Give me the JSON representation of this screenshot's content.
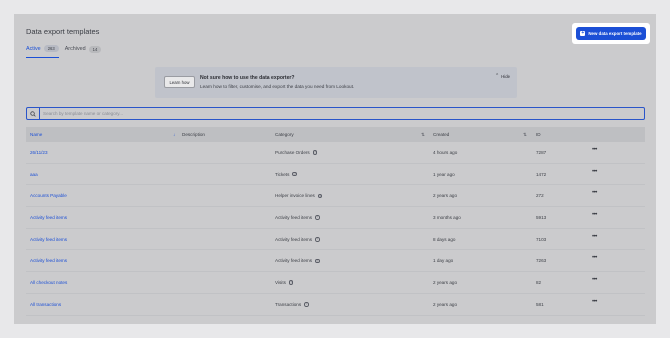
{
  "page": {
    "title": "Data export templates",
    "new_button_label": "New data export template"
  },
  "tabs": [
    {
      "label": "Active",
      "count": "263"
    },
    {
      "label": "Archived",
      "count": "14"
    }
  ],
  "banner": {
    "button_label": "Learn how",
    "title": "Not sure how to use the data exporter?",
    "description": "Learn how to filter, customise, and export the data you need from Lookout.",
    "hide_label": "Hide"
  },
  "search": {
    "placeholder": "Search by template name or category..."
  },
  "table": {
    "columns": {
      "name": "Name",
      "description": "Description",
      "category": "Category",
      "created": "Created",
      "id": "ID"
    },
    "rows": [
      {
        "name": "26/11/23",
        "description": "",
        "category": "Purchase Orders",
        "created": "4 hours ago",
        "id": "7287"
      },
      {
        "name": "aaa",
        "description": "",
        "category": "Tickets",
        "created": "1 year ago",
        "id": "1472"
      },
      {
        "name": "Accounts Payable",
        "description": "",
        "category": "Helper invoice lines",
        "created": "2 years ago",
        "id": "272"
      },
      {
        "name": "Activity feed items",
        "description": "",
        "category": "Activity feed items",
        "created": "3 months ago",
        "id": "5913"
      },
      {
        "name": "Activity feed items",
        "description": "",
        "category": "Activity feed items",
        "created": "8 days ago",
        "id": "7103"
      },
      {
        "name": "Activity feed items",
        "description": "",
        "category": "Activity feed items",
        "created": "1 day ago",
        "id": "7263"
      },
      {
        "name": "All checkout notes",
        "description": "",
        "category": "Visits",
        "created": "2 years ago",
        "id": "82"
      },
      {
        "name": "All transactions",
        "description": "",
        "category": "Transactions",
        "created": "2 years ago",
        "id": "581"
      }
    ]
  },
  "colors": {
    "accent": "#1b4fd6",
    "background": "#e8e8ea",
    "panel": "#cbcbcd"
  }
}
